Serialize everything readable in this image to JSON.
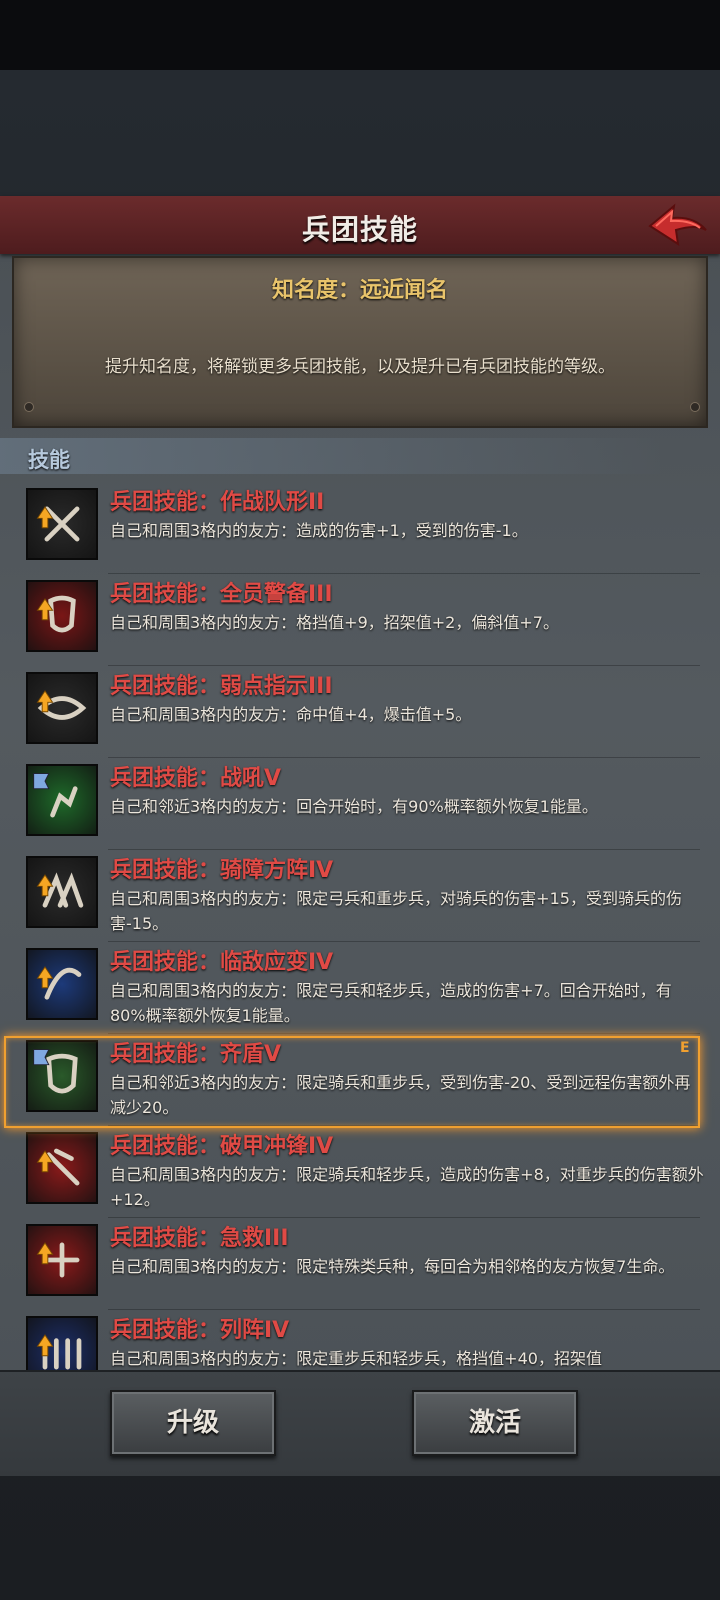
{
  "header": {
    "title": "兵团技能",
    "back_icon": "back-arrow-icon",
    "accent": "#c62d2d"
  },
  "fame": {
    "title": "知名度：远近闻名",
    "description": "提升知名度，将解锁更多兵团技能，以及提升已有兵团技能的等级。"
  },
  "section": {
    "label": "技能"
  },
  "skills": [
    {
      "title": "兵团技能：作战队形II",
      "desc": "自己和周围3格内的友方：造成的伤害+1，受到的伤害-1。",
      "icon": "crossed-swords-icon",
      "upgradeable": true
    },
    {
      "title": "兵团技能：全员警备III",
      "desc": "自己和周围3格内的友方：格挡值+9，招架值+2，偏斜值+7。",
      "icon": "shield-wall-icon",
      "upgradeable": true
    },
    {
      "title": "兵团技能：弱点指示III",
      "desc": "自己和周围3格内的友方：命中值+4，爆击值+5。",
      "icon": "target-eye-icon",
      "upgradeable": true
    },
    {
      "title": "兵团技能：战吼V",
      "desc": "自己和邻近3格内的友方：回合开始时，有90%概率额外恢复1能量。",
      "icon": "war-cry-icon",
      "upgradeable": false
    },
    {
      "title": "兵团技能：骑障方阵IV",
      "desc": "自己和周围3格内的友方：限定弓兵和重步兵，对骑兵的伤害+15，受到骑兵的伤害-15。",
      "icon": "horse-barrier-icon",
      "upgradeable": true
    },
    {
      "title": "兵团技能：临敌应变IV",
      "desc": "自己和周围3格内的友方：限定弓兵和轻步兵，造成的伤害+7。回合开始时，有80%概率额外恢复1能量。",
      "icon": "adapt-icon",
      "upgradeable": true
    },
    {
      "title": "兵团技能：齐盾V",
      "desc": "自己和邻近3格内的友方：限定骑兵和重步兵，受到伤害-20、受到远程伤害额外再减少20。",
      "icon": "shield-icon",
      "upgradeable": false,
      "badge": "E"
    },
    {
      "title": "兵团技能：破甲冲锋IV",
      "desc": "自己和周围3格内的友方：限定骑兵和轻步兵，造成的伤害+8，对重步兵的伤害额外+12。",
      "icon": "armor-break-icon",
      "upgradeable": true
    },
    {
      "title": "兵团技能：急救III",
      "desc": "自己和周围3格内的友方：限定特殊类兵种，每回合为相邻格的友方恢复7生命。",
      "icon": "first-aid-icon",
      "upgradeable": true
    },
    {
      "title": "兵团技能：列阵IV",
      "desc": "自己和周围3格内的友方：限定重步兵和轻步兵，格挡值+40，招架值",
      "icon": "formation-icon",
      "upgradeable": true
    }
  ],
  "buttons": {
    "upgrade": "升级",
    "activate": "激活"
  },
  "colors": {
    "skill_title": "#e04a45",
    "fame_title": "#e9c46b",
    "selection": "#f0a030",
    "upgrade_arrow": "#f5a623"
  }
}
